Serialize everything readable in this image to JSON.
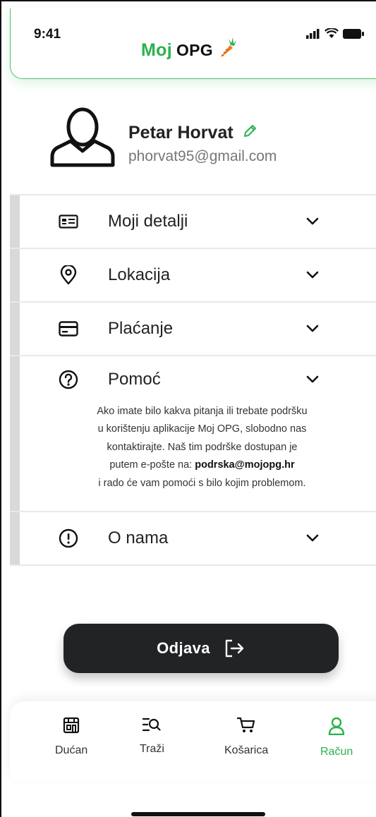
{
  "status_bar": {
    "time": "9:41"
  },
  "header": {
    "brand_left": "Moj",
    "brand_right": "OPG"
  },
  "profile": {
    "name": "Petar Horvat",
    "email": "phorvat95@gmail.com"
  },
  "menu": {
    "items": [
      {
        "label": "Moji detalji",
        "icon": "id-card-icon"
      },
      {
        "label": "Lokacija",
        "icon": "location-pin-icon"
      },
      {
        "label": "Plaćanje",
        "icon": "credit-card-icon"
      },
      {
        "label": "Pomoć",
        "icon": "help-circle-icon"
      },
      {
        "label": "O nama",
        "icon": "info-alert-icon"
      }
    ],
    "help": {
      "line1": "Ako imate bilo kakva pitanja ili trebate podršku",
      "line2": "u korištenju aplikacije Moj OPG, slobodno nas",
      "line3": "kontaktirajte. Naš tim podrške dostupan je",
      "line4_prefix": "putem e-pošte na: ",
      "email": "podrska@mojopg.hr",
      "line5": "i rado će vam pomoći s bilo kojim problemom."
    }
  },
  "logout": {
    "label": "Odjava"
  },
  "tabbar": {
    "items": [
      {
        "label": "Dućan",
        "icon": "store-icon"
      },
      {
        "label": "Traži",
        "icon": "search-list-icon"
      },
      {
        "label": "Košarica",
        "icon": "cart-icon"
      },
      {
        "label": "Račun",
        "icon": "user-icon",
        "active": true
      }
    ]
  },
  "colors": {
    "accent": "#2bb24c",
    "button": "#222325",
    "divider": "#e9e9e9",
    "rail": "#d9d9d9"
  }
}
